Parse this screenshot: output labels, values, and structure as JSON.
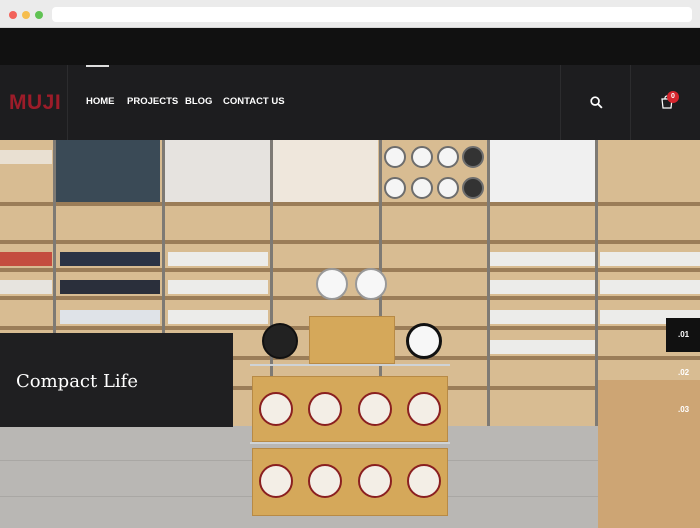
{
  "brand": {
    "logo": "MUJI",
    "accent": "#9c1c29"
  },
  "nav": {
    "items": [
      {
        "label": "HOME"
      },
      {
        "label": "PROJECTS"
      },
      {
        "label": "BLOG"
      },
      {
        "label": "CONTACT US"
      }
    ],
    "active_index": 0,
    "search_icon": "search-icon",
    "cart_icon": "cart-icon",
    "cart_count": "0"
  },
  "hero": {
    "caption": "Compact Life",
    "slides": [
      ".01",
      ".02",
      ".03"
    ],
    "active_slide": 0
  }
}
